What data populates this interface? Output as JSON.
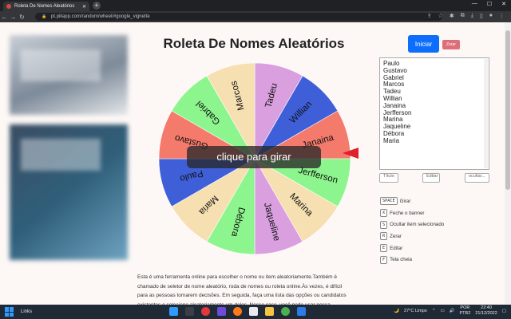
{
  "browser": {
    "tab_title": "Roleta De Nomes Aleatórios",
    "tab_close": "✕",
    "new_tab": "+",
    "url": "pt.piliapp.com/random/wheel/#google_vignette",
    "window_controls": [
      "—",
      "☐",
      "✕"
    ]
  },
  "page": {
    "title": "Roleta De Nomes Aleatórios",
    "start_button": "Iniciar",
    "reset_button": "Zerar",
    "center_label": "clique para girar",
    "names_text": "Paulo\nGustavo\nGabriel\nMarcos\nTadeu\nWillian\nJanaina\nJerfferson\nMarina\nJaqueline\nDébora\nMaria",
    "title_button": "Título",
    "edit_button": "Editar",
    "hide_button": "ocultar...",
    "shortcuts": [
      {
        "key": "SPACE",
        "label": "Girar"
      },
      {
        "key": "X",
        "label": "Feche o banner"
      },
      {
        "key": "S",
        "label": "Ocultar item selecionado"
      },
      {
        "key": "R",
        "label": "Zerar"
      },
      {
        "key": "E",
        "label": "Editar"
      },
      {
        "key": "F",
        "label": "Tela cheia"
      }
    ],
    "description": "Esta é uma ferramenta online para escolher o nome ou item aleatoriamente.Também é chamado de seletor de nome aleatório, roda de nomes ou roleta online.Às vezes, é difícil para as pessoas tomarem decisões. Em seguida, faça uma lista das opções ou candidatos existentes e selecione aleatoriamente um deles. Nesse caso, você pode usar nossa"
  },
  "wheel": {
    "segments": [
      {
        "label": "Tadeu",
        "color": "#d99fdf"
      },
      {
        "label": "Willian",
        "color": "#3f5fd9"
      },
      {
        "label": "Janaina",
        "color": "#f47a6c"
      },
      {
        "label": "Jerfferson",
        "color": "#8df58d"
      },
      {
        "label": "Marina",
        "color": "#f6dfb1"
      },
      {
        "label": "Jaqueline",
        "color": "#d99fdf"
      },
      {
        "label": "Débora",
        "color": "#8df58d"
      },
      {
        "label": "Maria",
        "color": "#f6dfb1"
      },
      {
        "label": "Paulo",
        "color": "#3f5fd9"
      },
      {
        "label": "Gustavo",
        "color": "#f47a6c"
      },
      {
        "label": "Gabriel",
        "color": "#8df58d"
      },
      {
        "label": "Marcos",
        "color": "#f6dfb1"
      }
    ]
  },
  "taskbar": {
    "search_label": "Links",
    "weather": "27°C  Limpo",
    "language": "POR\nPTB2",
    "time": "22:40",
    "date": "21/12/2022"
  }
}
